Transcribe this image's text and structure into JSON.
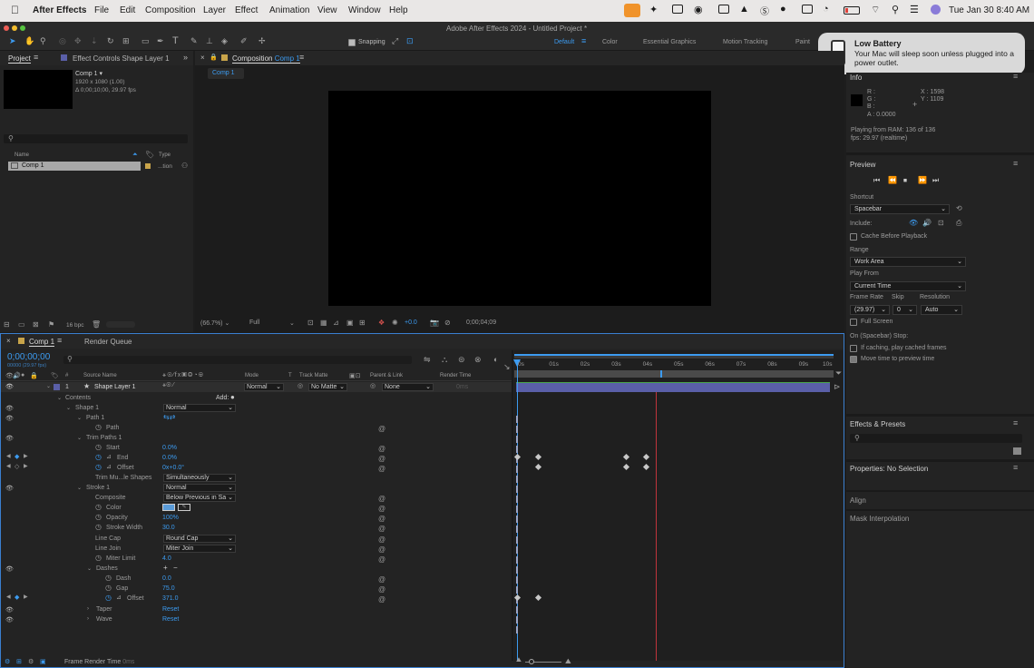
{
  "menubar": {
    "app": "After Effects",
    "items": [
      "File",
      "Edit",
      "Composition",
      "Layer",
      "Effect",
      "Animation",
      "View",
      "Window",
      "Help"
    ],
    "datetime": "Tue Jan 30  8:40 AM"
  },
  "window_title": "Adobe After Effects 2024 - Untitled Project *",
  "toolbar": {
    "snapping": "Snapping",
    "workspaces": [
      "Default",
      "Color",
      "Essential Graphics",
      "Motion Tracking",
      "Paint"
    ]
  },
  "notification": {
    "title": "Low Battery",
    "body": "Your Mac will sleep soon unless plugged into a power outlet."
  },
  "project": {
    "tab": "Project",
    "effect_tab": "Effect Controls Shape Layer 1",
    "comp_name": "Comp 1 ▾",
    "comp_size": "1920 x 1080 (1.00)",
    "comp_duration": "Δ 0;00;10;00, 29.97 fps",
    "col_name": "Name",
    "col_type": "Type",
    "item_name": "Comp 1",
    "item_type": "...tion",
    "bpc": "16 bpc"
  },
  "composition": {
    "tab": "Composition",
    "tab_link": "Comp 1",
    "subtab": "Comp 1",
    "zoom": "(66.7%)",
    "resolution": "Full",
    "exposure": "+0.0",
    "timecode": "0;00;04;09"
  },
  "info": {
    "title": "Info",
    "r": "R :",
    "g": "G :",
    "b": "B :",
    "a": "A :  0.0000",
    "x": "X : 1598",
    "y": "Y : 1109",
    "playing": "Playing from RAM: 136 of 136",
    "fps": "fps: 29.97 (realtime)"
  },
  "preview": {
    "title": "Preview",
    "shortcut_label": "Shortcut",
    "shortcut": "Spacebar",
    "include_label": "Include:",
    "cache": "Cache Before Playback",
    "range_label": "Range",
    "range": "Work Area",
    "playfrom_label": "Play From",
    "playfrom": "Current Time",
    "framerate_label": "Frame Rate",
    "skip_label": "Skip",
    "resolution_label": "Resolution",
    "framerate": "(29.97)",
    "skip": "0",
    "resolution": "Auto",
    "fullscreen": "Full Screen",
    "stop_label": "On (Spacebar) Stop:",
    "if_caching": "If caching, play cached frames",
    "move_time": "Move time to preview time"
  },
  "right_panels": {
    "effects": "Effects & Presets",
    "properties": "Properties: No Selection",
    "align": "Align",
    "mask": "Mask Interpolation"
  },
  "timeline": {
    "tab": "Comp 1",
    "render_queue": "Render Queue",
    "timecode": "0;00;00;00",
    "timecode_sub": "00000 (29.97 fps)",
    "col_num": "#",
    "col_source": "Source Name",
    "col_mode": "Mode",
    "col_t": "T",
    "col_trackmatte": "Track Matte",
    "col_parent": "Parent & Link",
    "col_rendertime": "Render Time",
    "ruler": [
      "0s",
      "01s",
      "02s",
      "03s",
      "04s",
      "05s",
      "06s",
      "07s",
      "08s",
      "09s",
      "10s"
    ],
    "layer_num": "1",
    "layer_name": "Shape Layer 1",
    "layer_mode": "Normal",
    "layer_matte": "No Matte",
    "layer_parent": "None",
    "layer_rtime": "0ms",
    "contents": "Contents",
    "add": "Add:",
    "shape1": "Shape 1",
    "shape1_mode": "Normal",
    "path1": "Path 1",
    "path": "Path",
    "trim": "Trim Paths 1",
    "start": "Start",
    "start_val": "0.0%",
    "end": "End",
    "end_val": "0.0%",
    "offset": "Offset",
    "offset_val": "0x+0.0°",
    "trim_multi": "Trim Mu...le Shapes",
    "trim_multi_val": "Simultaneously",
    "stroke": "Stroke 1",
    "stroke_mode": "Normal",
    "composite": "Composite",
    "composite_val": "Below Previous in Sa",
    "color": "Color",
    "opacity": "Opacity",
    "opacity_val": "100%",
    "stroke_width": "Stroke Width",
    "stroke_width_val": "30.0",
    "line_cap": "Line Cap",
    "line_cap_val": "Round Cap",
    "line_join": "Line Join",
    "line_join_val": "Miter Join",
    "miter": "Miter Limit",
    "miter_val": "4.0",
    "dashes": "Dashes",
    "dash": "Dash",
    "dash_val": "0.0",
    "gap": "Gap",
    "gap_val": "75.0",
    "dash_offset": "Offset",
    "dash_offset_val": "371.0",
    "taper": "Taper",
    "taper_val": "Reset",
    "wave": "Wave",
    "wave_val": "Reset",
    "frame_render": "Frame Render Time",
    "frame_render_val": "0ms"
  },
  "colors": {
    "accent": "#3c9bf0",
    "layer_bar": "#5a5fa8",
    "playhead": "#c0343c",
    "battery_red": "#e0413a"
  }
}
